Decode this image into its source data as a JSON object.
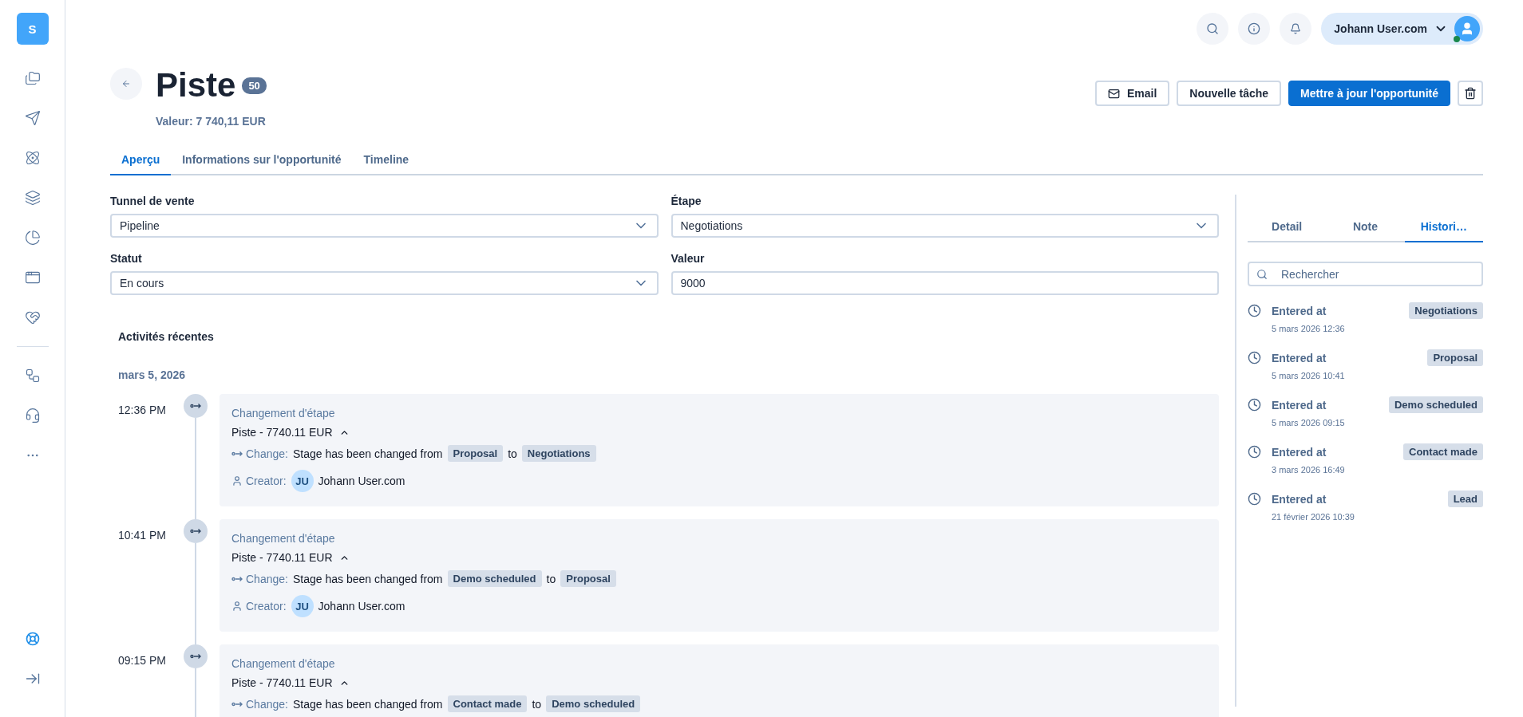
{
  "sidebar": {
    "logo": "S"
  },
  "topbar": {
    "user": {
      "name": "Johann User.com",
      "online": true
    }
  },
  "header": {
    "title": "Piste",
    "badge": "50",
    "value": "Valeur: 7 740,11 EUR",
    "actions": [
      {
        "kind": "outline",
        "label": "Email"
      },
      {
        "kind": "outline",
        "label": "Nouvelle tâche"
      },
      {
        "kind": "primary",
        "label": "Mettre à jour l'opportunité"
      },
      {
        "kind": "icon"
      }
    ]
  },
  "tabs": [
    {
      "label": "Aperçu",
      "selected": true
    },
    {
      "label": "Informations sur l'opportunité",
      "selected": false
    },
    {
      "label": "Timeline",
      "selected": false
    }
  ],
  "form": {
    "fields": [
      {
        "label": "Tunnel de vente",
        "value": "Pipeline",
        "kind": "select"
      },
      {
        "label": "Étape",
        "value": "Negotiations",
        "kind": "select"
      },
      {
        "label": "Statut",
        "value": "En cours",
        "kind": "select"
      },
      {
        "label": "Valeur",
        "value": "9000",
        "kind": "input"
      }
    ]
  },
  "activity": {
    "title": "Activités récentes",
    "date": "mars 5, 2026",
    "items": [
      {
        "time": "12:36 PM",
        "type": "Changement d'étape",
        "title": "Piste - 7740.11 EUR",
        "expanded": true,
        "change_label": "Change:",
        "text": "Stage has been changed from",
        "from": "Proposal",
        "connector": "to",
        "to": "Negotiations",
        "creator_label": "Creator:",
        "initials": "JU",
        "creator": "Johann User.com"
      },
      {
        "time": "10:41 PM",
        "type": "Changement d'étape",
        "title": "Piste - 7740.11 EUR",
        "expanded": true,
        "change_label": "Change:",
        "text": "Stage has been changed from",
        "from": "Demo scheduled",
        "connector": "to",
        "to": "Proposal",
        "creator_label": "Creator:",
        "initials": "JU",
        "creator": "Johann User.com"
      },
      {
        "time": "09:15 PM",
        "type": "Changement d'étape",
        "title": "Piste - 7740.11 EUR",
        "expanded": true,
        "change_label": "Change:",
        "text": "Stage has been changed from",
        "from": "Contact made",
        "connector": "to",
        "to": "Demo scheduled"
      }
    ]
  },
  "side_panel": {
    "tabs": [
      {
        "label": "Detail",
        "selected": false
      },
      {
        "label": "Note",
        "selected": false
      },
      {
        "label": "Histori…",
        "selected": true
      }
    ],
    "search": {
      "placeholder": "Rechercher"
    },
    "history": [
      {
        "label": "Entered at",
        "date": "5 mars 2026 12:36",
        "stage": "Negotiations"
      },
      {
        "label": "Entered at",
        "date": "5 mars 2026 10:41",
        "stage": "Proposal"
      },
      {
        "label": "Entered at",
        "date": "5 mars 2026 09:15",
        "stage": "Demo scheduled"
      },
      {
        "label": "Entered at",
        "date": "3 mars 2026 16:49",
        "stage": "Contact made"
      },
      {
        "label": "Entered at",
        "date": "21 février 2026 10:39",
        "stage": "Lead"
      }
    ]
  }
}
